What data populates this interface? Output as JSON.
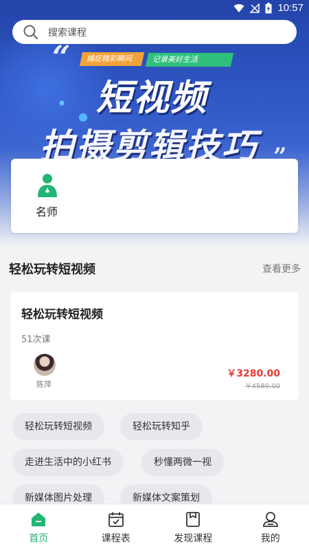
{
  "status_bar": {
    "time": "10:57"
  },
  "search": {
    "placeholder": "搜索课程"
  },
  "banner": {
    "tag_left": "捕捉精彩瞬间",
    "tag_right": "记录美好生活",
    "headline_1": "短视频",
    "headline_2": "拍摄剪辑技巧",
    "quote_open": "“",
    "quote_close": "”"
  },
  "teacher_card": {
    "label": "名师"
  },
  "section": {
    "title": "轻松玩转短视频",
    "see_more": "查看更多"
  },
  "course": {
    "title": "轻松玩转短视频",
    "count": "51次课",
    "teacher": "陈萍",
    "price": "￥3280.00",
    "original_price": "￥4580.00"
  },
  "tags": [
    "轻松玩转短视频",
    "轻松玩转知乎",
    "走进生活中的小红书",
    "秒懂两微一视",
    "新媒体图片处理",
    "新媒体文案策划"
  ],
  "bottom_nav": [
    {
      "label": "首页",
      "icon": "home-icon",
      "active": true
    },
    {
      "label": "课程表",
      "icon": "calendar-icon",
      "active": false
    },
    {
      "label": "发现课程",
      "icon": "discover-icon",
      "active": false
    },
    {
      "label": "我的",
      "icon": "profile-icon",
      "active": false
    }
  ],
  "colors": {
    "accent": "#22b573",
    "price": "#e53935",
    "banner": "#2f57c4"
  }
}
